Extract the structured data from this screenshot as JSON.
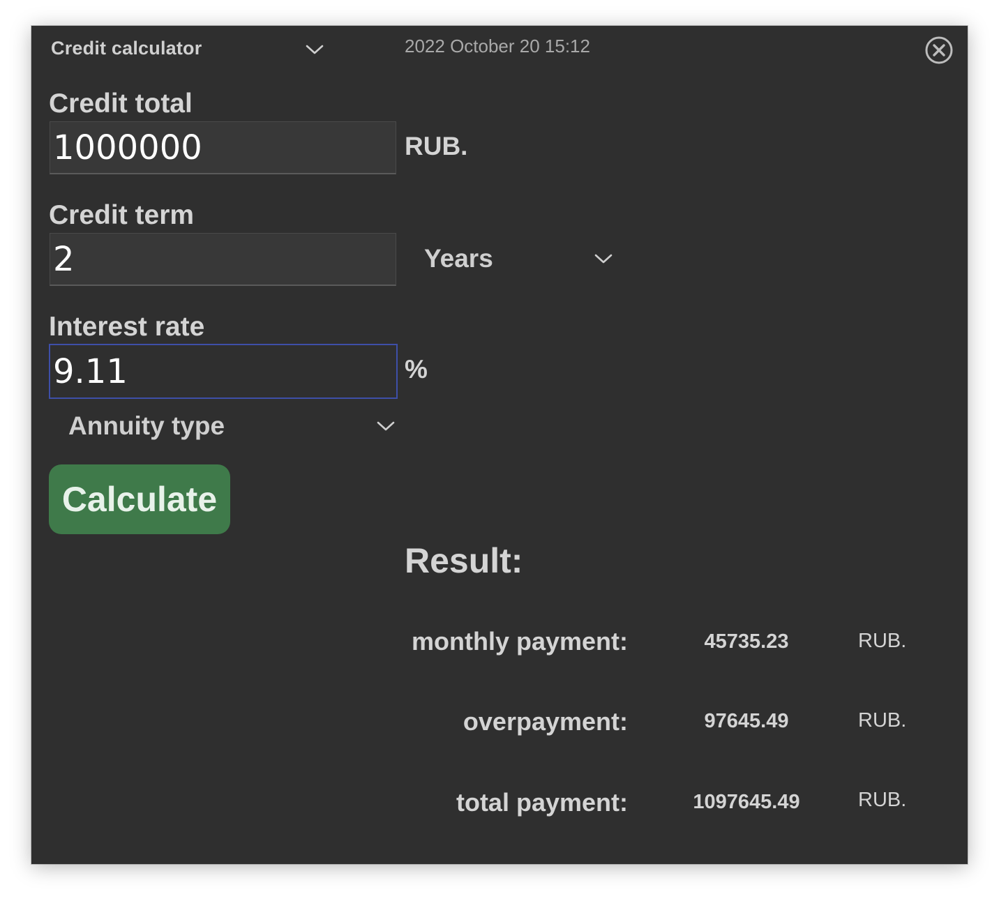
{
  "header": {
    "title": "Credit calculator",
    "datetime": "2022 October 20 15:12"
  },
  "form": {
    "credit_total": {
      "label": "Credit total",
      "value": "1000000",
      "unit": "RUB."
    },
    "credit_term": {
      "label": "Credit term",
      "value": "2",
      "unit_selected": "Years"
    },
    "interest_rate": {
      "label": "Interest rate",
      "value": "9.11",
      "unit": "%"
    },
    "type_selected": "Annuity type",
    "calculate_label": "Calculate"
  },
  "result": {
    "title": "Result:",
    "rows": [
      {
        "label": "monthly payment:",
        "value": "45735.23",
        "unit": "RUB."
      },
      {
        "label": "overpayment:",
        "value": "97645.49",
        "unit": "RUB."
      },
      {
        "label": "total payment:",
        "value": "1097645.49",
        "unit": "RUB."
      }
    ]
  },
  "colors": {
    "window_bg": "#2f2f2f",
    "button_green": "#3f7a4a",
    "focus_border": "#3e4fa8"
  },
  "icons": {
    "dropdown": "chevron-down-icon",
    "close": "close-circle-icon"
  }
}
